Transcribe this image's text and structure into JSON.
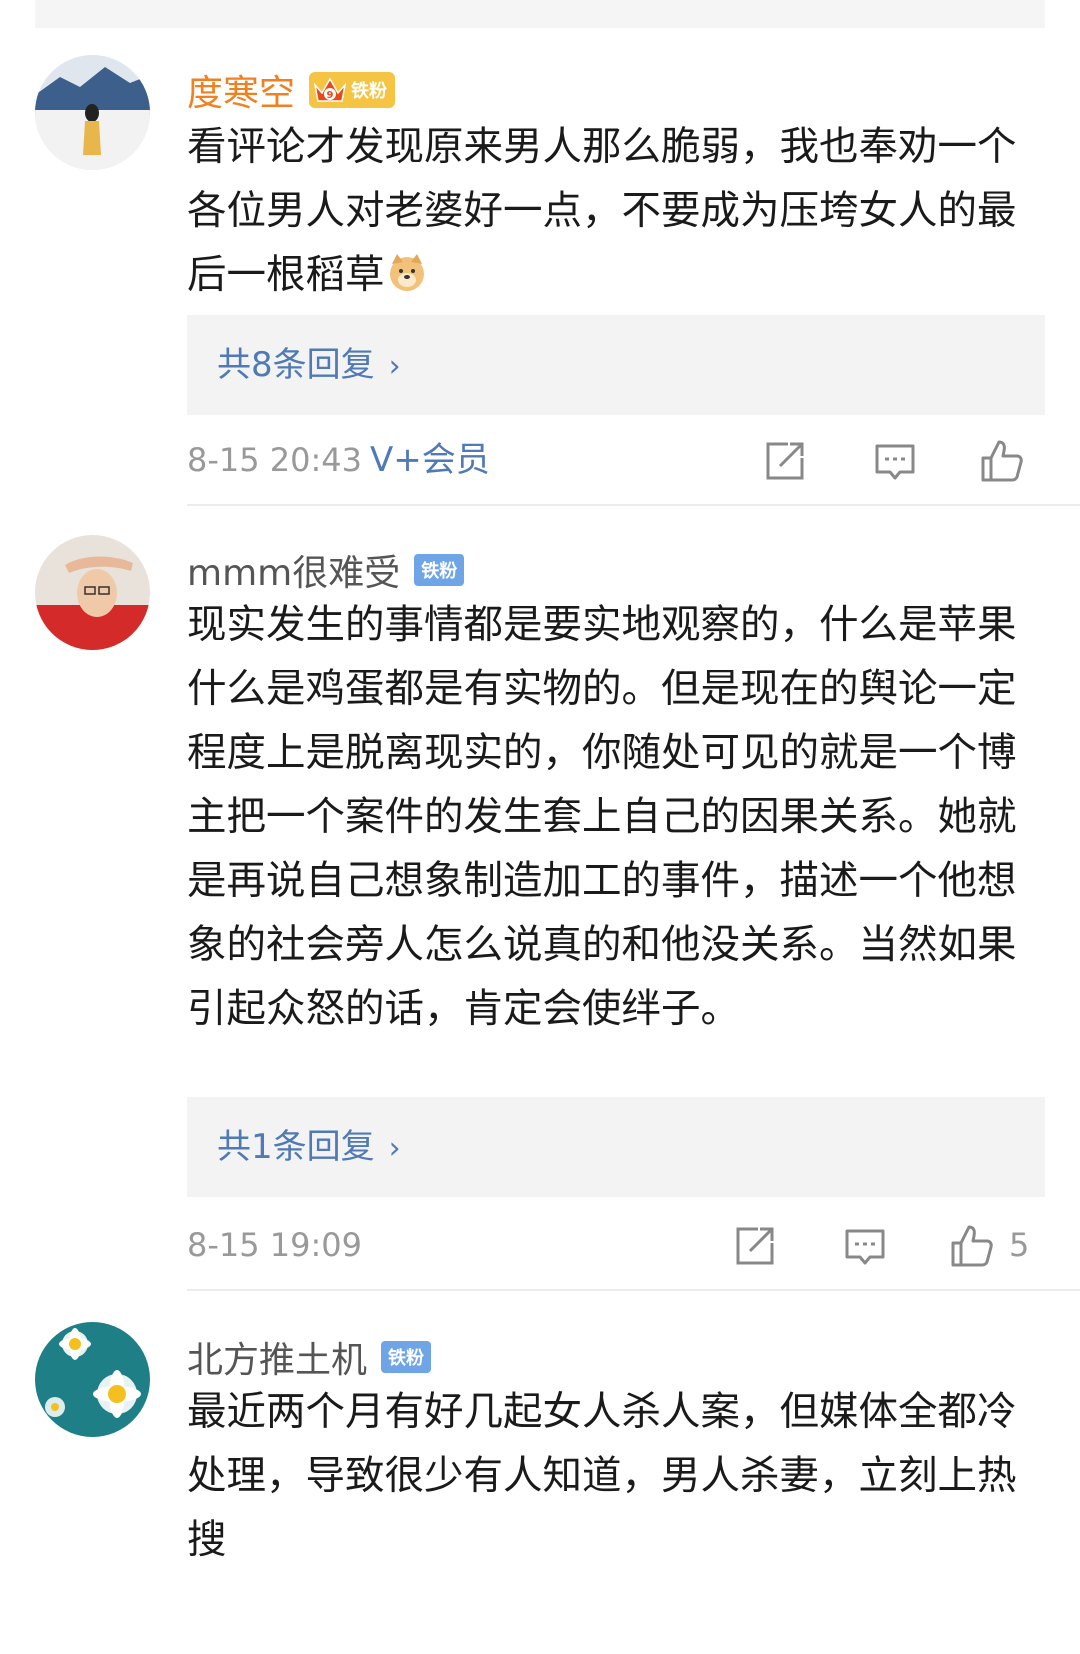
{
  "comments": [
    {
      "username": "度寒空",
      "badge": "铁粉",
      "vip_level": "9",
      "text": "看评论才发现原来男人那么脆弱，我也奉劝一个各位男人对老婆好一点，不要成为压垮女人的最后一根稻草",
      "emoji": "doge-emoji",
      "reply_label": "共8条回复",
      "time": "8-15 20:43",
      "member_label": "V+会员",
      "like_count": ""
    },
    {
      "username": "mmm很难受",
      "badge": "铁粉",
      "text": "现实发生的事情都是要实地观察的，什么是苹果什么是鸡蛋都是有实物的。但是现在的舆论一定程度上是脱离现实的，你随处可见的就是一个博主把一个案件的发生套上自己的因果关系。她就是再说自己想象制造加工的事件，描述一个他想象的社会旁人怎么说真的和他没关系。当然如果引起众怒的话，肯定会使绊子。",
      "reply_label": "共1条回复",
      "time": "8-15 19:09",
      "like_count": "5"
    },
    {
      "username": "北方推土机",
      "badge": "铁粉",
      "text": "最近两个月有好几起女人杀人案，但媒体全都冷处理，导致很少有人知道，男人杀妻，立刻上热搜"
    }
  ],
  "icons": {
    "repost": "repost-icon",
    "comment": "comment-icon",
    "like": "like-icon",
    "chevron": "chevron-right-icon"
  },
  "colors": {
    "link_blue": "#4f7ab5",
    "vip_orange": "#f08020",
    "fan_badge": "#6fa5e6",
    "meta_gray": "#999999",
    "reply_bg": "#f3f3f3"
  },
  "glyphs": {
    "chevron": "›"
  }
}
